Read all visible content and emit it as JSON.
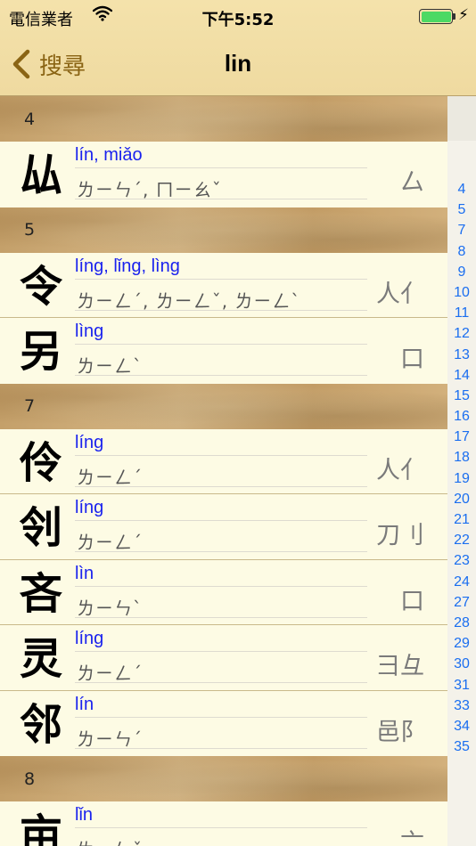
{
  "status": {
    "carrier": "電信業者",
    "time": "下午5:52"
  },
  "nav": {
    "back_label": "搜尋",
    "title": "lin"
  },
  "sections": [
    {
      "header": "4",
      "rows": [
        {
          "char": "厸",
          "pinyin": "lín, miǎo",
          "zhuyin": "ㄌㄧㄣˊ, ㄇㄧㄠˇ",
          "radical": "厶"
        }
      ]
    },
    {
      "header": "5",
      "rows": [
        {
          "char": "令",
          "pinyin": "líng, lǐng, lìng",
          "zhuyin": "ㄌㄧㄥˊ, ㄌㄧㄥˇ, ㄌㄧㄥˋ",
          "radical": "人亻"
        },
        {
          "char": "另",
          "pinyin": "lìng",
          "zhuyin": "ㄌㄧㄥˋ",
          "radical": "口"
        }
      ]
    },
    {
      "header": "7",
      "rows": [
        {
          "char": "伶",
          "pinyin": "líng",
          "zhuyin": "ㄌㄧㄥˊ",
          "radical": "人亻"
        },
        {
          "char": "刢",
          "pinyin": "líng",
          "zhuyin": "ㄌㄧㄥˊ",
          "radical": "刀刂"
        },
        {
          "char": "吝",
          "pinyin": "lìn",
          "zhuyin": "ㄌㄧㄣˋ",
          "radical": "口"
        },
        {
          "char": "灵",
          "pinyin": "líng",
          "zhuyin": "ㄌㄧㄥˊ",
          "radical": "彐彑"
        },
        {
          "char": "邻",
          "pinyin": "lín",
          "zhuyin": "ㄌㄧㄣˊ",
          "radical": "邑阝"
        }
      ]
    },
    {
      "header": "8",
      "rows": [
        {
          "char": "亩",
          "pinyin": "lǐn",
          "zhuyin": "ㄌㄧㄣˇ",
          "radical": "亠"
        }
      ]
    }
  ],
  "index": [
    "4",
    "5",
    "7",
    "8",
    "9",
    "10",
    "11",
    "12",
    "13",
    "14",
    "15",
    "16",
    "17",
    "18",
    "19",
    "20",
    "21",
    "22",
    "23",
    "24",
    "27",
    "28",
    "29",
    "30",
    "31",
    "33",
    "34",
    "35"
  ],
  "colors": {
    "accent": "#8a6414",
    "pinyin": "#1a22ee",
    "index": "#1a6ef0",
    "battery": "#4cd964"
  }
}
